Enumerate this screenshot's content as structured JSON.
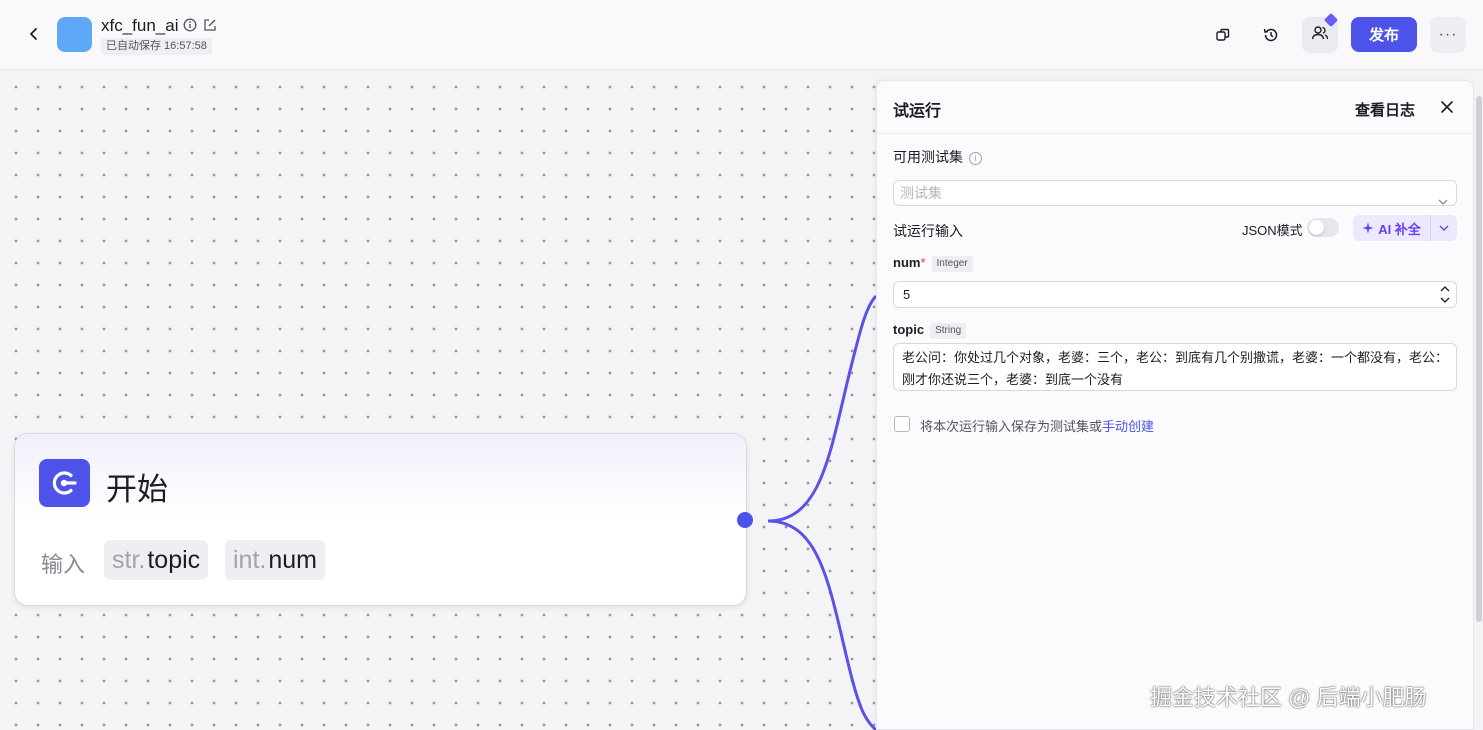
{
  "header": {
    "app_title": "xfc_fun_ai",
    "saved_status": "已自动保存 16:57:58",
    "publish_label": "发布",
    "more_label": "···",
    "icons": [
      "back-icon",
      "info-icon",
      "edit-icon",
      "copy-icon",
      "history-icon",
      "collaborators-icon",
      "more-icon"
    ]
  },
  "canvas": {
    "start_node": {
      "title": "开始",
      "input_label": "输入",
      "params": [
        {
          "type": "str.",
          "name": "topic"
        },
        {
          "type": "int.",
          "name": "num"
        }
      ]
    }
  },
  "panel": {
    "title": "试运行",
    "view_log": "查看日志",
    "testset_label": "可用测试集",
    "testset_placeholder": "测试集",
    "run_input_label": "试运行输入",
    "json_mode_label": "JSON模式",
    "ai_complete_label": "AI 补全",
    "fields": [
      {
        "name": "num",
        "required": true,
        "type": "Integer",
        "value": "5"
      },
      {
        "name": "topic",
        "required": false,
        "type": "String",
        "value": "老公问：你处过几个对象，老婆：三个，老公：到底有几个别撒谎，老婆：一个都没有，老公：刚才你还说三个，老婆：到底一个没有"
      }
    ],
    "save_text": "将本次运行输入保存为测试集或",
    "save_link": "手动创建"
  },
  "watermark": "掘金技术社区 @ 后端小肥肠",
  "colors": {
    "primary": "#4d53e8",
    "ai_purple": "#6a3df6",
    "app_avatar": "#5fa8f7",
    "edge": "#5a52e6",
    "required": "#e53242"
  }
}
